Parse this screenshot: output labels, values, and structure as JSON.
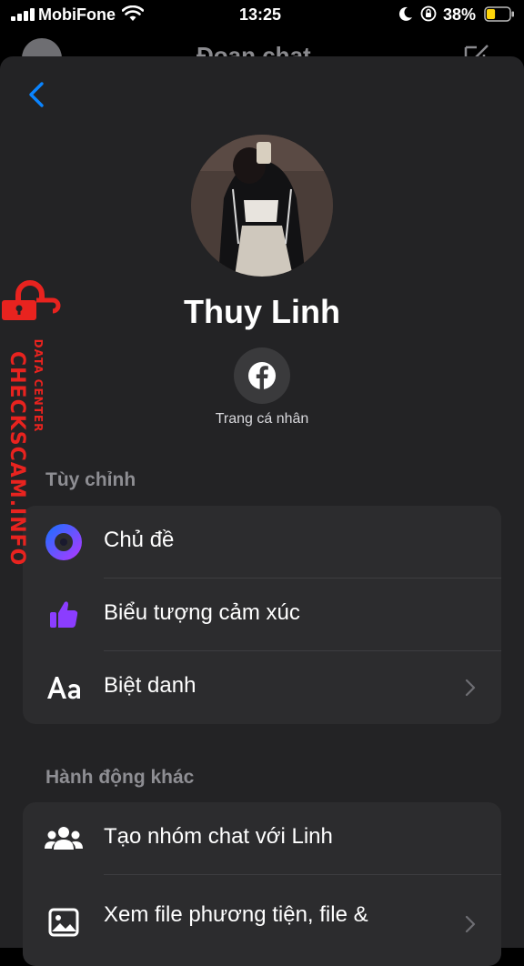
{
  "status_bar": {
    "carrier": "MobiFone",
    "time": "13:25",
    "battery_percent": "38%",
    "battery_level": 0.38,
    "battery_color": "#FFD60A"
  },
  "background_header": {
    "title": "Đoạn chat"
  },
  "profile": {
    "name": "Thuy Linh",
    "facebook_label": "Trang cá nhân"
  },
  "sections": {
    "customize": {
      "title": "Tùy chỉnh",
      "items": [
        {
          "label": "Chủ đề",
          "icon": "theme-icon"
        },
        {
          "label": "Biểu tượng cảm xúc",
          "icon": "thumbs-up-icon"
        },
        {
          "label": "Biệt danh",
          "icon": "aa-icon"
        }
      ]
    },
    "other_actions": {
      "title": "Hành động khác",
      "items": [
        {
          "label": "Tạo nhóm chat với Linh",
          "icon": "group-icon"
        },
        {
          "label": "Xem file phương tiện, file &",
          "icon": "image-icon"
        }
      ]
    }
  },
  "watermark": {
    "brand": "CHECKSCAM.INFO",
    "subtitle": "DATA CENTER"
  },
  "colors": {
    "accent_blue": "#0A84FF",
    "thumb_purple": "#8B3DFF",
    "watermark_red": "#E8231F"
  }
}
